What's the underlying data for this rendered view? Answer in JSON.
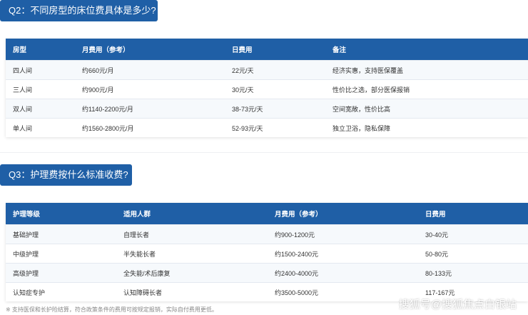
{
  "q2": {
    "title": "Q2：不同房型的床位费具体是多少?",
    "headers": [
      "房型",
      "月费用（参考）",
      "日费用",
      "备注"
    ],
    "rows": [
      [
        "四人间",
        "约660元/月",
        "22元/天",
        "经济实惠，支持医保覆盖"
      ],
      [
        "三人间",
        "约900元/月",
        "30元/天",
        "性价比之选，部分医保报销"
      ],
      [
        "双人间",
        "约1140-2200元/月",
        "38-73元/天",
        "空间宽敞，性价比高"
      ],
      [
        "单人间",
        "约1560-2800元/月",
        "52-93元/天",
        "独立卫浴，隐私保障"
      ]
    ]
  },
  "q3": {
    "title": "Q3：护理费按什么标准收费?",
    "headers": [
      "护理等级",
      "适用人群",
      "月费用（参考）",
      "日费用"
    ],
    "rows": [
      [
        "基础护理",
        "自理长者",
        "约900-1200元",
        "30-40元"
      ],
      [
        "中级护理",
        "半失能长者",
        "约1500-2400元",
        "50-80元"
      ],
      [
        "高级护理",
        "全失能/术后康复",
        "约2400-4000元",
        "80-133元"
      ],
      [
        "认知症专护",
        "认知障碍长者",
        "约3500-5000元",
        "117-167元"
      ]
    ]
  },
  "footnote": "※ 支持医保和长护险结算，符合政策条件的费用可按规定报销，实际自付费用更低。",
  "watermark": "搜狐号@搜狐焦点白银站"
}
